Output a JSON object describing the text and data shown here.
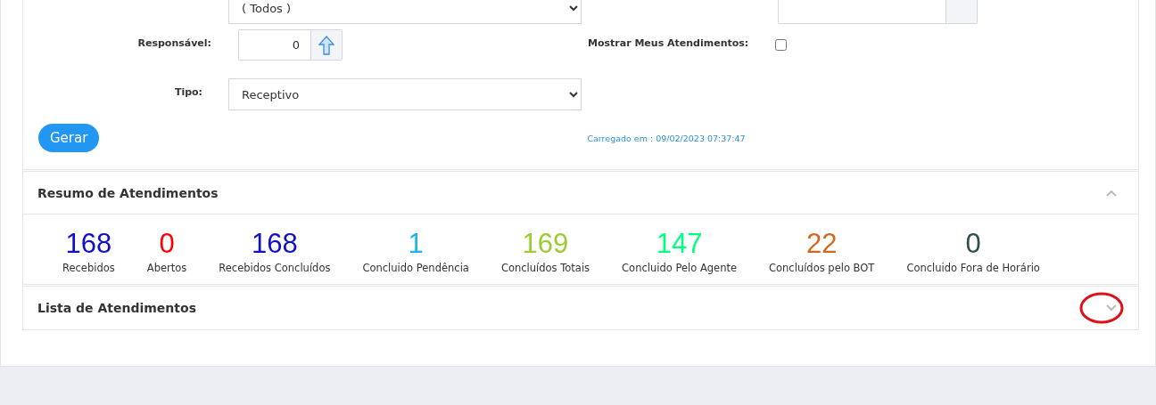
{
  "filters": {
    "top_select": {
      "value": "( Todos )"
    },
    "responsavel": {
      "label": "Responsável:",
      "value": "0"
    },
    "mostrar": {
      "label": "Mostrar Meus Atendimentos:",
      "checked": false
    },
    "tipo": {
      "label": "Tipo:",
      "value": "Receptivo"
    }
  },
  "generate_button": "Gerar",
  "loaded_at": "Carregado em : 09/02/2023 07:37:47",
  "summary": {
    "title": "Resumo de Atendimentos",
    "expanded": true,
    "stats": [
      {
        "value": "168",
        "label": "Recebidos",
        "color": "#1010c8"
      },
      {
        "value": "0",
        "label": "Abertos",
        "color": "#ff0000"
      },
      {
        "value": "168",
        "label": "Recebidos Concluídos",
        "color": "#1010c8"
      },
      {
        "value": "1",
        "label": "Concluido Pendência",
        "color": "#1ab4f5"
      },
      {
        "value": "169",
        "label": "Concluídos Totais",
        "color": "#9acd32"
      },
      {
        "value": "147",
        "label": "Concluido Pelo Agente",
        "color": "#00ff7f"
      },
      {
        "value": "22",
        "label": "Concluídos pelo BOT",
        "color": "#d2691e"
      },
      {
        "value": "0",
        "label": "Concluido Fora de Horário",
        "color": "#2f4f4f"
      }
    ]
  },
  "list": {
    "title": "Lista de Atendimentos",
    "expanded": false
  }
}
